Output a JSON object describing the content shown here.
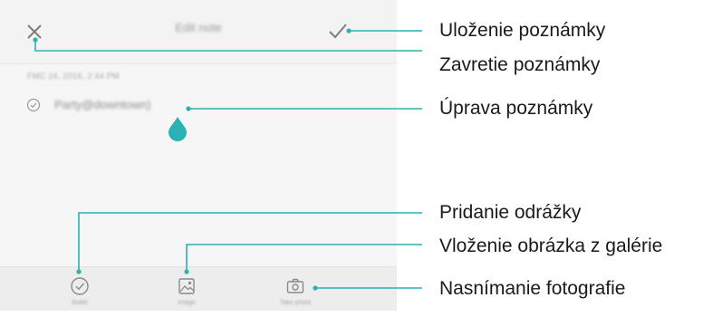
{
  "editor": {
    "title": "Edit note",
    "date": "FMC 24, 2016, 2:44 PM",
    "note_text": "Party@downtown)",
    "toolbar": [
      {
        "id": "bullet",
        "icon": "check-circle-icon",
        "label": "Bullet"
      },
      {
        "id": "image",
        "icon": "image-icon",
        "label": "Image"
      },
      {
        "id": "camera",
        "icon": "camera-icon",
        "label": "Take photo"
      }
    ]
  },
  "callouts": {
    "save": "Uloženie poznámky",
    "close": "Zavretie poznámky",
    "edit": "Úprava poznámky",
    "bullet": "Pridanie odrážky",
    "gallery": "Vloženie obrázka z galérie",
    "photo": "Nasnímanie fotografie"
  },
  "colors": {
    "accent": "#2ab1b4",
    "icon": "#8a8a8a",
    "background": "#f6f6f6",
    "toolbar": "#ededed"
  }
}
